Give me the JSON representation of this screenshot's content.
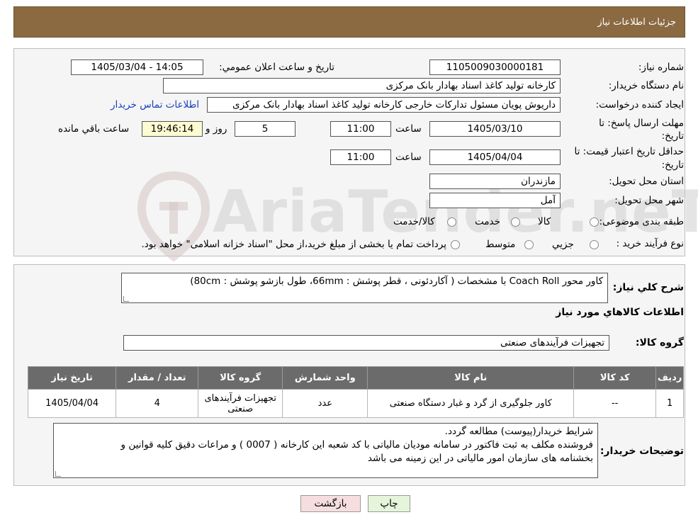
{
  "page": {
    "title": "جزئیات اطلاعات نیاز"
  },
  "form": {
    "need_number_label": "شماره نیاز:",
    "need_number": "1105009030000181",
    "announce_label": "تاریخ و ساعت اعلان عمومي:",
    "announce_value": "1405/03/04 - 14:05",
    "buyer_org_label": "نام دستگاه خریدار:",
    "buyer_org": "کارخانه تولید کاغذ اسناد بهادار بانک مرکزی",
    "creator_label": "ایجاد کننده درخواست:",
    "creator": "داریوش  پویان مسئول تدارکات خارجی کارخانه تولید کاغذ اسناد بهادار بانک مرکزی",
    "contact_link": "اطلاعات تماس خریدار",
    "deadline_label": "مهلت ارسال پاسخ: تا",
    "deadline_label2": "تاریخ:",
    "deadline_date": "1405/03/10",
    "time_word": "ساعت",
    "deadline_time": "11:00",
    "days_value": "5",
    "days_word": "روز و",
    "remaining_time": "19:46:14",
    "remaining_word": "ساعت باقي مانده",
    "validity_label": "حداقل تاریخ اعتبار قیمت: تا",
    "validity_label2": "تاریخ:",
    "validity_date": "1405/04/04",
    "validity_time": "11:00",
    "province_label": "استان محل تحویل:",
    "province": "مازندران",
    "city_label": "شهر محل تحویل:",
    "city": "آمل",
    "category_label": "طبقه بندی موضوعی:",
    "category_options": [
      "کالا",
      "خدمت",
      "کالا/خدمت"
    ],
    "process_label": "نوع فرآیند خرید :",
    "process_options": [
      "جزیي",
      "متوسط"
    ],
    "process_note": "پرداخت تمام یا بخشی از مبلغ خرید،از محل \"اسناد خزانه اسلامی\" خواهد بود."
  },
  "description": {
    "label": "شرح كلي نياز:",
    "value": "کاور محور Coach Roll با مشخصات ( آکاردئونی ، قطر پوشش : 66mm، طول بازشو پوشش : 80cm)"
  },
  "goods_info": {
    "heading": "اطلاعات كالاهاي مورد نياز",
    "group_label": "گروه کالا:",
    "group_value": "تجهیزات فرآیندهای صنعتی"
  },
  "table": {
    "headers": [
      "ردیف",
      "کد کالا",
      "نام کالا",
      "واحد شمارش",
      "گروه کالا",
      "تعداد / مقدار",
      "تاریخ نیاز"
    ],
    "rows": [
      [
        "1",
        "--",
        "کاور جلوگیری از گرد و غبار دستگاه صنعتی",
        "عدد",
        "تجهیزات فرآیندهای صنعتی",
        "4",
        "1405/04/04"
      ]
    ]
  },
  "buyer_notes": {
    "label": "توضیحات خریدار:",
    "lines": [
      "شرایط  خریدار(پیوست) مطالعه گردد.",
      " فروشنده مکلف به ثبت فاکتور در سامانه مودیان مالیاتی با کد شعبه این کارخانه ( 0007 ) و مراعات دقیق کلیه قوانین و",
      "بخشنامه های سازمان امور مالیاتی در این زمینه می باشد"
    ]
  },
  "buttons": {
    "print": "چاپ",
    "back": "بازگشت"
  },
  "watermark": {
    "text": "AriaTender.neT"
  },
  "colors": {
    "header_brown": "#8b6a42",
    "table_header": "#6b6b6b",
    "link": "#1b3fb8",
    "back_button": "#f6dede",
    "print_button": "#e4f5dc"
  }
}
